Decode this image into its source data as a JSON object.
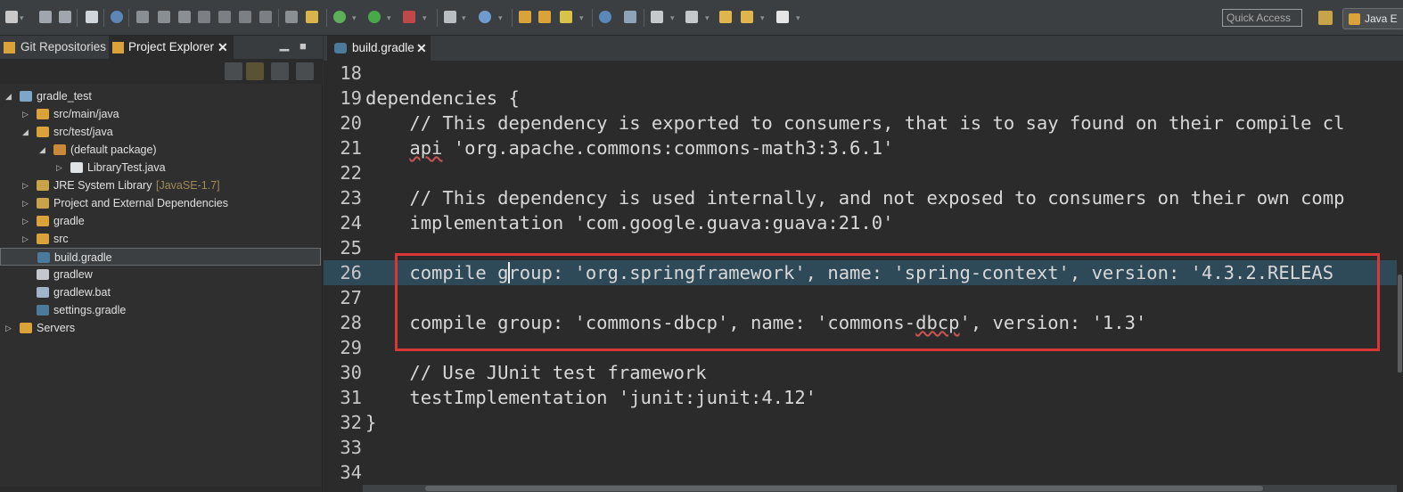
{
  "toolbar": {
    "quick_access_placeholder": "Quick Access",
    "perspective_label": "Java E",
    "icons": [
      "new-icon",
      "save-icon",
      "save-all-icon",
      "print-icon",
      "skip-breakpoints-icon",
      "resume-icon",
      "suspend-icon",
      "terminate-icon",
      "disconnect-icon",
      "step-into-icon",
      "step-over-icon",
      "step-return-icon",
      "drop-to-frame-icon",
      "use-step-filters-icon",
      "debug-icon",
      "run-icon",
      "coverage-icon",
      "external-tools-icon",
      "new-java-project-icon",
      "new-package-icon",
      "new-class-icon",
      "open-type-icon",
      "open-task-icon",
      "search-icon",
      "globe-icon",
      "annotation-icon",
      "last-edit-icon",
      "back-icon",
      "forward-icon"
    ]
  },
  "left_view": {
    "tabs": [
      {
        "label": "Git Repositories",
        "icon": "git-repo-icon"
      },
      {
        "label": "Project Explorer",
        "icon": "project-explorer-icon"
      }
    ],
    "tree": [
      {
        "label": "gradle_test",
        "level": 0,
        "expanded": true,
        "icon": "gradle-project-icon"
      },
      {
        "label": "src/main/java",
        "level": 1,
        "expanded": false,
        "icon": "source-folder-icon"
      },
      {
        "label": "src/test/java",
        "level": 1,
        "expanded": true,
        "icon": "source-folder-icon"
      },
      {
        "label": "(default package)",
        "level": 2,
        "expanded": true,
        "icon": "package-icon"
      },
      {
        "label": "LibraryTest.java",
        "level": 3,
        "expanded": false,
        "icon": "java-file-icon"
      },
      {
        "label": "JRE System Library",
        "decoration": "[JavaSE-1.7]",
        "level": 1,
        "expanded": false,
        "icon": "library-icon"
      },
      {
        "label": "Project and External Dependencies",
        "level": 1,
        "expanded": false,
        "icon": "library-icon"
      },
      {
        "label": "gradle",
        "level": 1,
        "expanded": false,
        "icon": "folder-icon"
      },
      {
        "label": "src",
        "level": 1,
        "expanded": false,
        "icon": "folder-icon"
      },
      {
        "label": "build.gradle",
        "level": 1,
        "leaf": true,
        "icon": "gradle-file-icon",
        "selected": true
      },
      {
        "label": "gradlew",
        "level": 1,
        "leaf": true,
        "icon": "file-icon"
      },
      {
        "label": "gradlew.bat",
        "level": 1,
        "leaf": true,
        "icon": "bat-file-icon"
      },
      {
        "label": "settings.gradle",
        "level": 1,
        "leaf": true,
        "icon": "gradle-file-icon"
      },
      {
        "label": "Servers",
        "level": 0,
        "expanded": false,
        "icon": "folder-icon"
      }
    ]
  },
  "editor": {
    "tab_label": "build.gradle",
    "lines": [
      {
        "num": "18",
        "text": ""
      },
      {
        "num": "19",
        "text": "dependencies {"
      },
      {
        "num": "20",
        "text": "    // This dependency is exported to consumers, that is to say found on their compile cl"
      },
      {
        "num": "21",
        "text": "    api 'org.apache.commons:commons-math3:3.6.1'"
      },
      {
        "num": "22",
        "text": ""
      },
      {
        "num": "23",
        "text": "    // This dependency is used internally, and not exposed to consumers on their own comp"
      },
      {
        "num": "24",
        "text": "    implementation 'com.google.guava:guava:21.0'"
      },
      {
        "num": "25",
        "text": ""
      },
      {
        "num": "26",
        "text": "    compile group: 'org.springframework', name: 'spring-context', version: '4.3.2.RELEAS"
      },
      {
        "num": "27",
        "text": ""
      },
      {
        "num": "28",
        "text": "    compile group: 'commons-dbcp', name: 'commons-dbcp', version: '1.3'"
      },
      {
        "num": "29",
        "text": ""
      },
      {
        "num": "30",
        "text": "    // Use JUnit test framework"
      },
      {
        "num": "31",
        "text": "    testImplementation 'junit:junit:4.12'"
      },
      {
        "num": "32",
        "text": "}"
      },
      {
        "num": "33",
        "text": ""
      },
      {
        "num": "34",
        "text": ""
      }
    ],
    "current_line": "26"
  },
  "colors": {
    "background": "#2b2b2b",
    "current_line": "#2e4a59",
    "highlight_box": "#d93636",
    "text": "#d8d8d8"
  }
}
